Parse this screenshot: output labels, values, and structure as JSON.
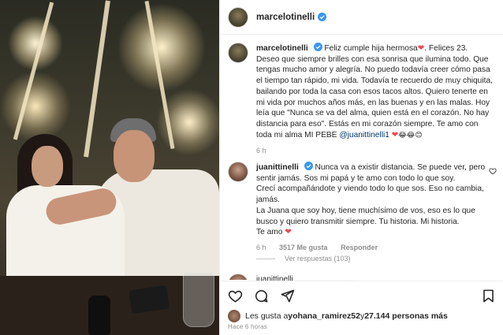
{
  "header": {
    "username": "marcelotinelli"
  },
  "caption": {
    "username": "marcelotinelli",
    "text_before_heart": "Feliz cumple hija hermosa",
    "text_body": ". Felices 23. Deseo que siempre brilles con esa sonrisa que ilumina todo. Que tengas mucho amor y alegría. No puedo todavía creer cómo pasa el tiempo tan rápido, mi vida. Todavía te recuerdo de muy chiquita, bailando por toda la casa con esos tacos altos. Quiero tenerte en mi vida por muchos años más, en las buenas y en las malas. Hoy leía que \"Nunca se va del alma, quien está en el corazón. No hay distancia para eso\". Estás en mi corazón siempre. Te amo con toda mi alma MI PEBE ",
    "mention": "@juanittinelli1",
    "emojis": "😂😂😊",
    "heart": "❤",
    "time": "6 h"
  },
  "comment": {
    "username": "juanittinelli",
    "lines": [
      "Nunca va a existir distancia. Se puede ver, pero sentir jamás. Sos mi papá y te amo con todo lo que soy.",
      "Crecí acompañándote y viendo todo lo que sos. Eso no cambia, jamás.",
      "La Juana que soy hoy, tiene muchísimo de vos, eso es lo que busco y quiero transmitir siempre. Tu historia. Mi historia.",
      "Te amo"
    ],
    "heart": "❤",
    "time": "6 h",
    "likes": "3517 Me gusta",
    "reply_label": "Responder",
    "view_replies": "Ver respuestas (103)"
  },
  "next_comment_preview": "juanittinelli  ...........................",
  "likes_bar": {
    "prefix": "Les gusta a ",
    "user": "yohana_ramirez52",
    "middle": " y ",
    "count": "27.144 personas más"
  },
  "timestamp": "Hace 6 horas",
  "icons": {
    "like": "heart-outline-icon",
    "comment": "comment-bubble-icon",
    "share": "send-paper-plane-icon",
    "save": "bookmark-icon",
    "verified": "verified-badge-icon"
  },
  "colors": {
    "verified": "#3897f0",
    "heart": "#ed4956",
    "link": "#00376b",
    "muted": "#8e8e8e"
  }
}
